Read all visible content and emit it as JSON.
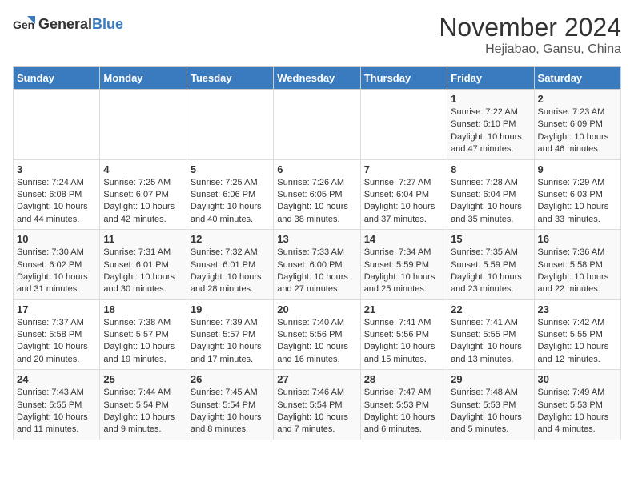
{
  "header": {
    "logo_general": "General",
    "logo_blue": "Blue",
    "title": "November 2024",
    "subtitle": "Hejiabao, Gansu, China"
  },
  "weekdays": [
    "Sunday",
    "Monday",
    "Tuesday",
    "Wednesday",
    "Thursday",
    "Friday",
    "Saturday"
  ],
  "weeks": [
    [
      {
        "day": "",
        "content": ""
      },
      {
        "day": "",
        "content": ""
      },
      {
        "day": "",
        "content": ""
      },
      {
        "day": "",
        "content": ""
      },
      {
        "day": "",
        "content": ""
      },
      {
        "day": "1",
        "content": "Sunrise: 7:22 AM\nSunset: 6:10 PM\nDaylight: 10 hours and 47 minutes."
      },
      {
        "day": "2",
        "content": "Sunrise: 7:23 AM\nSunset: 6:09 PM\nDaylight: 10 hours and 46 minutes."
      }
    ],
    [
      {
        "day": "3",
        "content": "Sunrise: 7:24 AM\nSunset: 6:08 PM\nDaylight: 10 hours and 44 minutes."
      },
      {
        "day": "4",
        "content": "Sunrise: 7:25 AM\nSunset: 6:07 PM\nDaylight: 10 hours and 42 minutes."
      },
      {
        "day": "5",
        "content": "Sunrise: 7:25 AM\nSunset: 6:06 PM\nDaylight: 10 hours and 40 minutes."
      },
      {
        "day": "6",
        "content": "Sunrise: 7:26 AM\nSunset: 6:05 PM\nDaylight: 10 hours and 38 minutes."
      },
      {
        "day": "7",
        "content": "Sunrise: 7:27 AM\nSunset: 6:04 PM\nDaylight: 10 hours and 37 minutes."
      },
      {
        "day": "8",
        "content": "Sunrise: 7:28 AM\nSunset: 6:04 PM\nDaylight: 10 hours and 35 minutes."
      },
      {
        "day": "9",
        "content": "Sunrise: 7:29 AM\nSunset: 6:03 PM\nDaylight: 10 hours and 33 minutes."
      }
    ],
    [
      {
        "day": "10",
        "content": "Sunrise: 7:30 AM\nSunset: 6:02 PM\nDaylight: 10 hours and 31 minutes."
      },
      {
        "day": "11",
        "content": "Sunrise: 7:31 AM\nSunset: 6:01 PM\nDaylight: 10 hours and 30 minutes."
      },
      {
        "day": "12",
        "content": "Sunrise: 7:32 AM\nSunset: 6:01 PM\nDaylight: 10 hours and 28 minutes."
      },
      {
        "day": "13",
        "content": "Sunrise: 7:33 AM\nSunset: 6:00 PM\nDaylight: 10 hours and 27 minutes."
      },
      {
        "day": "14",
        "content": "Sunrise: 7:34 AM\nSunset: 5:59 PM\nDaylight: 10 hours and 25 minutes."
      },
      {
        "day": "15",
        "content": "Sunrise: 7:35 AM\nSunset: 5:59 PM\nDaylight: 10 hours and 23 minutes."
      },
      {
        "day": "16",
        "content": "Sunrise: 7:36 AM\nSunset: 5:58 PM\nDaylight: 10 hours and 22 minutes."
      }
    ],
    [
      {
        "day": "17",
        "content": "Sunrise: 7:37 AM\nSunset: 5:58 PM\nDaylight: 10 hours and 20 minutes."
      },
      {
        "day": "18",
        "content": "Sunrise: 7:38 AM\nSunset: 5:57 PM\nDaylight: 10 hours and 19 minutes."
      },
      {
        "day": "19",
        "content": "Sunrise: 7:39 AM\nSunset: 5:57 PM\nDaylight: 10 hours and 17 minutes."
      },
      {
        "day": "20",
        "content": "Sunrise: 7:40 AM\nSunset: 5:56 PM\nDaylight: 10 hours and 16 minutes."
      },
      {
        "day": "21",
        "content": "Sunrise: 7:41 AM\nSunset: 5:56 PM\nDaylight: 10 hours and 15 minutes."
      },
      {
        "day": "22",
        "content": "Sunrise: 7:41 AM\nSunset: 5:55 PM\nDaylight: 10 hours and 13 minutes."
      },
      {
        "day": "23",
        "content": "Sunrise: 7:42 AM\nSunset: 5:55 PM\nDaylight: 10 hours and 12 minutes."
      }
    ],
    [
      {
        "day": "24",
        "content": "Sunrise: 7:43 AM\nSunset: 5:55 PM\nDaylight: 10 hours and 11 minutes."
      },
      {
        "day": "25",
        "content": "Sunrise: 7:44 AM\nSunset: 5:54 PM\nDaylight: 10 hours and 9 minutes."
      },
      {
        "day": "26",
        "content": "Sunrise: 7:45 AM\nSunset: 5:54 PM\nDaylight: 10 hours and 8 minutes."
      },
      {
        "day": "27",
        "content": "Sunrise: 7:46 AM\nSunset: 5:54 PM\nDaylight: 10 hours and 7 minutes."
      },
      {
        "day": "28",
        "content": "Sunrise: 7:47 AM\nSunset: 5:53 PM\nDaylight: 10 hours and 6 minutes."
      },
      {
        "day": "29",
        "content": "Sunrise: 7:48 AM\nSunset: 5:53 PM\nDaylight: 10 hours and 5 minutes."
      },
      {
        "day": "30",
        "content": "Sunrise: 7:49 AM\nSunset: 5:53 PM\nDaylight: 10 hours and 4 minutes."
      }
    ]
  ]
}
